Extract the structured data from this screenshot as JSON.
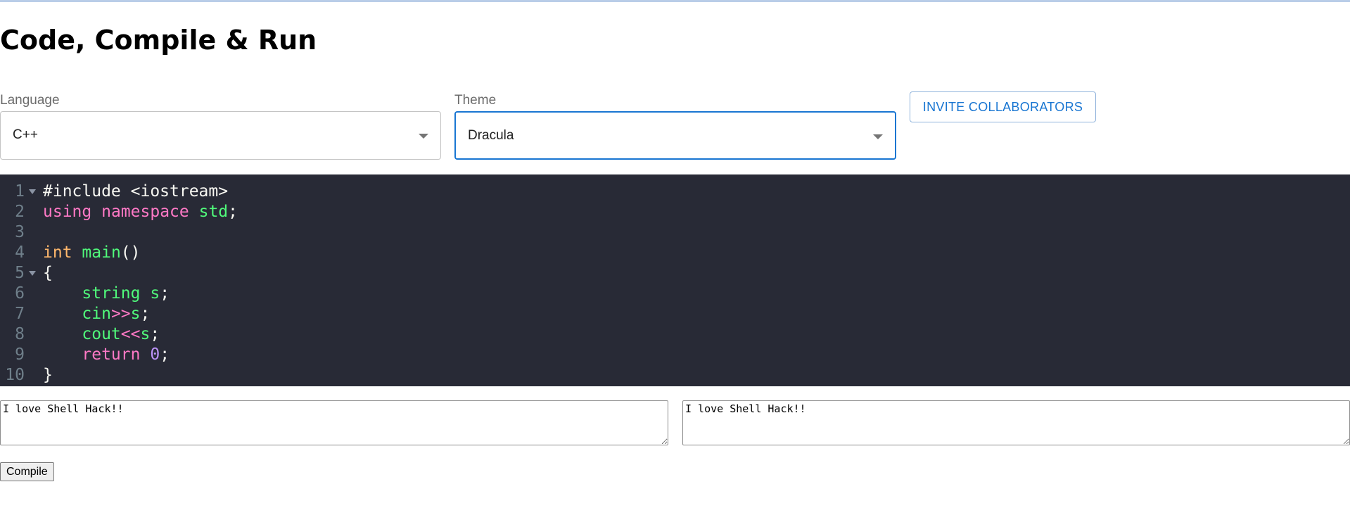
{
  "page": {
    "title": "Code, Compile & Run"
  },
  "controls": {
    "language": {
      "label": "Language",
      "value": "C++"
    },
    "theme": {
      "label": "Theme",
      "value": "Dracula"
    },
    "invite_label": "INVITE COLLABORATORS"
  },
  "editor": {
    "lines": [
      {
        "num": "1",
        "foldable": true,
        "tokens": [
          [
            "t",
            "#include <iostream>"
          ]
        ]
      },
      {
        "num": "2",
        "foldable": false,
        "tokens": [
          [
            "k",
            "using"
          ],
          [
            "t",
            " "
          ],
          [
            "k",
            "namespace"
          ],
          [
            "t",
            " "
          ],
          [
            "g",
            "std"
          ],
          [
            "t",
            ";"
          ]
        ]
      },
      {
        "num": "3",
        "foldable": false,
        "tokens": []
      },
      {
        "num": "4",
        "foldable": false,
        "tokens": [
          [
            "o",
            "int"
          ],
          [
            "t",
            " "
          ],
          [
            "g",
            "main"
          ],
          [
            "t",
            "()"
          ]
        ]
      },
      {
        "num": "5",
        "foldable": true,
        "tokens": [
          [
            "t",
            "{"
          ]
        ]
      },
      {
        "num": "6",
        "foldable": false,
        "tokens": [
          [
            "t",
            "    "
          ],
          [
            "g",
            "string"
          ],
          [
            "t",
            " "
          ],
          [
            "g",
            "s"
          ],
          [
            "t",
            ";"
          ]
        ]
      },
      {
        "num": "7",
        "foldable": false,
        "tokens": [
          [
            "t",
            "    "
          ],
          [
            "g",
            "cin"
          ],
          [
            "k",
            ">>"
          ],
          [
            "g",
            "s"
          ],
          [
            "t",
            ";"
          ]
        ]
      },
      {
        "num": "8",
        "foldable": false,
        "tokens": [
          [
            "t",
            "    "
          ],
          [
            "g",
            "cout"
          ],
          [
            "k",
            "<<"
          ],
          [
            "g",
            "s"
          ],
          [
            "t",
            ";"
          ]
        ]
      },
      {
        "num": "9",
        "foldable": false,
        "tokens": [
          [
            "t",
            "    "
          ],
          [
            "k",
            "return"
          ],
          [
            "t",
            " "
          ],
          [
            "n",
            "0"
          ],
          [
            "t",
            ";"
          ]
        ]
      },
      {
        "num": "10",
        "foldable": false,
        "tokens": [
          [
            "t",
            "}"
          ]
        ]
      }
    ]
  },
  "io": {
    "input_value": "I love Shell Hack!!",
    "output_value": "I love Shell Hack!!"
  },
  "actions": {
    "compile_label": "Compile"
  },
  "colors": {
    "accent": "#1976d2",
    "editor_bg": "#282a36",
    "keyword": "#ff79c6",
    "function": "#50fa7b",
    "type": "#ffb86c",
    "number": "#bd93f9"
  },
  "icons": {
    "select_arrow": "caret-down-icon",
    "fold_marker": "fold-triangle-icon"
  }
}
